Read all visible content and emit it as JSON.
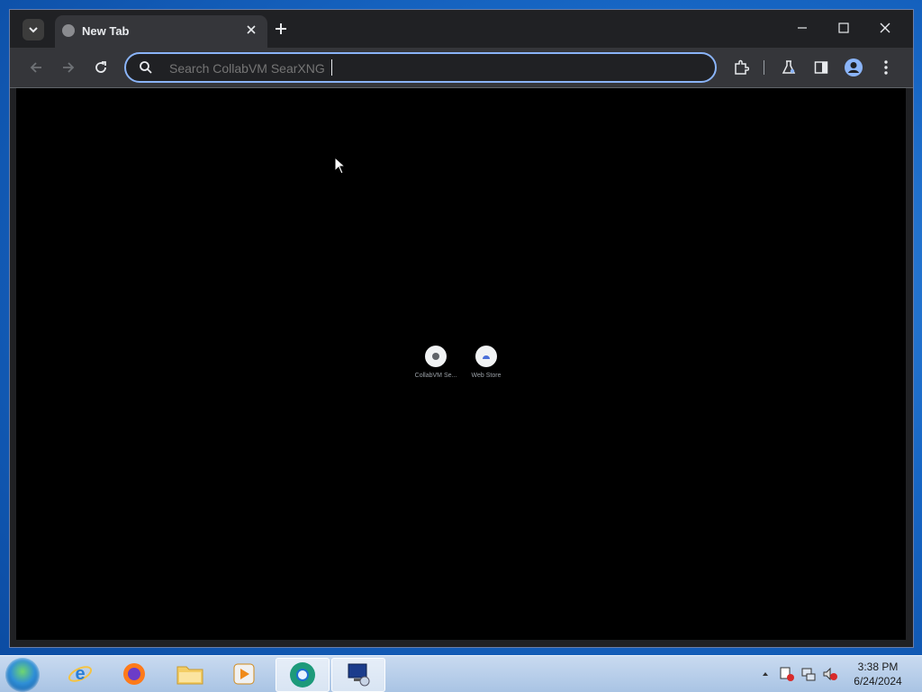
{
  "browser": {
    "tab": {
      "title": "New Tab"
    },
    "omnibox": {
      "placeholder": "Search CollabVM SearXNG"
    },
    "shortcuts": [
      {
        "label": "CollabVM Se..."
      },
      {
        "label": "Web Store"
      }
    ]
  },
  "taskbar": {
    "apps": [
      "internet-explorer",
      "firefox",
      "file-explorer",
      "media-player",
      "chrome",
      "remote-desktop"
    ],
    "clock": {
      "time": "3:38 PM",
      "date": "6/24/2024"
    }
  },
  "colors": {
    "accent": "#8ab4f8",
    "tab_bg": "#35363a",
    "content_bg": "#000000"
  }
}
